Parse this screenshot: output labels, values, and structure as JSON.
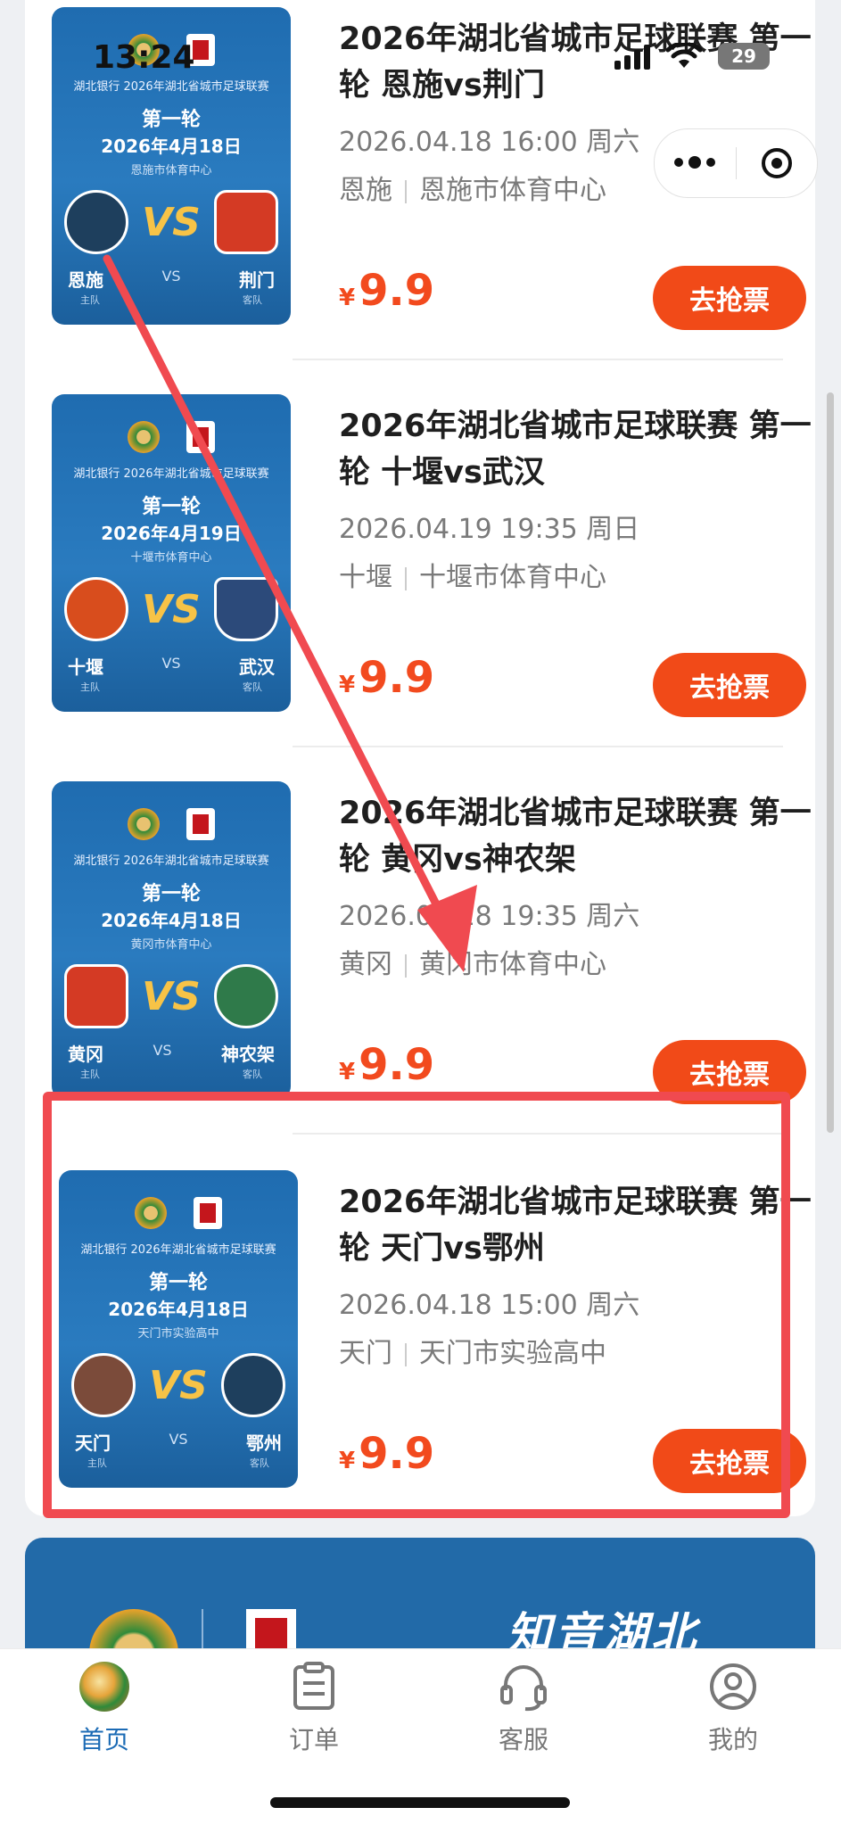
{
  "status_bar": {
    "time": "13:24",
    "battery": "29"
  },
  "matches": [
    {
      "title": "2026年湖北省城市足球联赛 第一轮 恩施vs荆门",
      "datetime": "2026.04.18 16:00 周六",
      "city": "恩施",
      "venue": "恩施市体育中心",
      "price_currency": "¥",
      "price": "9.9",
      "buy_label": "去抢票",
      "poster": {
        "league": "湖北银行 2026年湖北省城市足球联赛",
        "round": "第一轮",
        "date": "2026年4月18日",
        "venue": "恩施市体育中心",
        "home": "恩施",
        "away": "荆门",
        "vs": "VS",
        "home_role": "主队",
        "away_role": "客队"
      }
    },
    {
      "title": "2026年湖北省城市足球联赛 第一轮 十堰vs武汉",
      "datetime": "2026.04.19 19:35 周日",
      "city": "十堰",
      "venue": "十堰市体育中心",
      "price_currency": "¥",
      "price": "9.9",
      "buy_label": "去抢票",
      "poster": {
        "league": "湖北银行 2026年湖北省城市足球联赛",
        "round": "第一轮",
        "date": "2026年4月19日",
        "venue": "十堰市体育中心",
        "home": "十堰",
        "away": "武汉",
        "vs": "VS",
        "home_role": "主队",
        "away_role": "客队"
      }
    },
    {
      "title": "2026年湖北省城市足球联赛 第一轮 黄冈vs神农架",
      "datetime": "2026.04.18 19:35 周六",
      "city": "黄冈",
      "venue": "黄冈市体育中心",
      "price_currency": "¥",
      "price": "9.9",
      "buy_label": "去抢票",
      "poster": {
        "league": "湖北银行 2026年湖北省城市足球联赛",
        "round": "第一轮",
        "date": "2026年4月18日",
        "venue": "黄冈市体育中心",
        "home": "黄冈",
        "away": "神农架",
        "vs": "VS",
        "home_role": "主队",
        "away_role": "客队"
      }
    },
    {
      "title": "2026年湖北省城市足球联赛 第一轮 天门vs鄂州",
      "datetime": "2026.04.18 15:00 周六",
      "city": "天门",
      "venue": "天门市实验高中",
      "price_currency": "¥",
      "price": "9.9",
      "buy_label": "去抢票",
      "poster": {
        "league": "湖北银行 2026年湖北省城市足球联赛",
        "round": "第一轮",
        "date": "2026年4月18日",
        "venue": "天门市实验高中",
        "home": "天门",
        "away": "鄂州",
        "vs": "VS",
        "home_role": "主队",
        "away_role": "客队"
      }
    }
  ],
  "banner": {
    "slogan": "知音湖北"
  },
  "tabbar": [
    {
      "label": "首页",
      "icon": "home-ball-icon",
      "active": true
    },
    {
      "label": "订单",
      "icon": "order-clipboard-icon",
      "active": false
    },
    {
      "label": "客服",
      "icon": "headset-icon",
      "active": false
    },
    {
      "label": "我的",
      "icon": "user-icon",
      "active": false
    }
  ],
  "colors": {
    "accent": "#f14a18",
    "price": "#f24a1e",
    "highlight": "#f04a50",
    "poster_blue": "#1f6cb0",
    "active_tab": "#1c6bb5"
  }
}
